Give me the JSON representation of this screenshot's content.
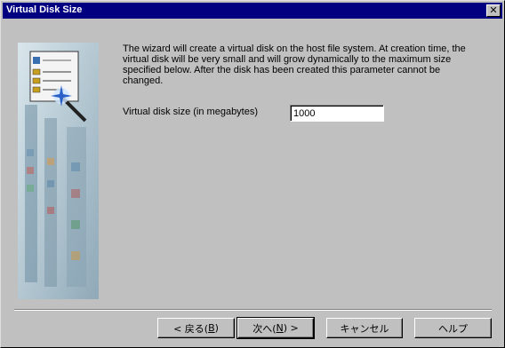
{
  "window": {
    "title": "Virtual Disk Size",
    "close_glyph": "✕"
  },
  "main": {
    "description": "The wizard will create a virtual disk on the host file system. At creation time, the virtual disk will be very small and will grow dynamically to the maximum size specified below. After the disk has been created this parameter cannot be changed.",
    "size_label": "Virtual disk size (in megabytes)",
    "size_value": "1000"
  },
  "buttons": {
    "back": {
      "label_before": "< 戻る(",
      "mnemonic": "B",
      "label_after": ")"
    },
    "next": {
      "label_before": "次へ(",
      "mnemonic": "N",
      "label_after": ") >"
    },
    "cancel": "キャンセル",
    "help": "ヘルプ"
  },
  "icons": {
    "side_image": "wizard-banner-icon",
    "close": "close-icon"
  }
}
